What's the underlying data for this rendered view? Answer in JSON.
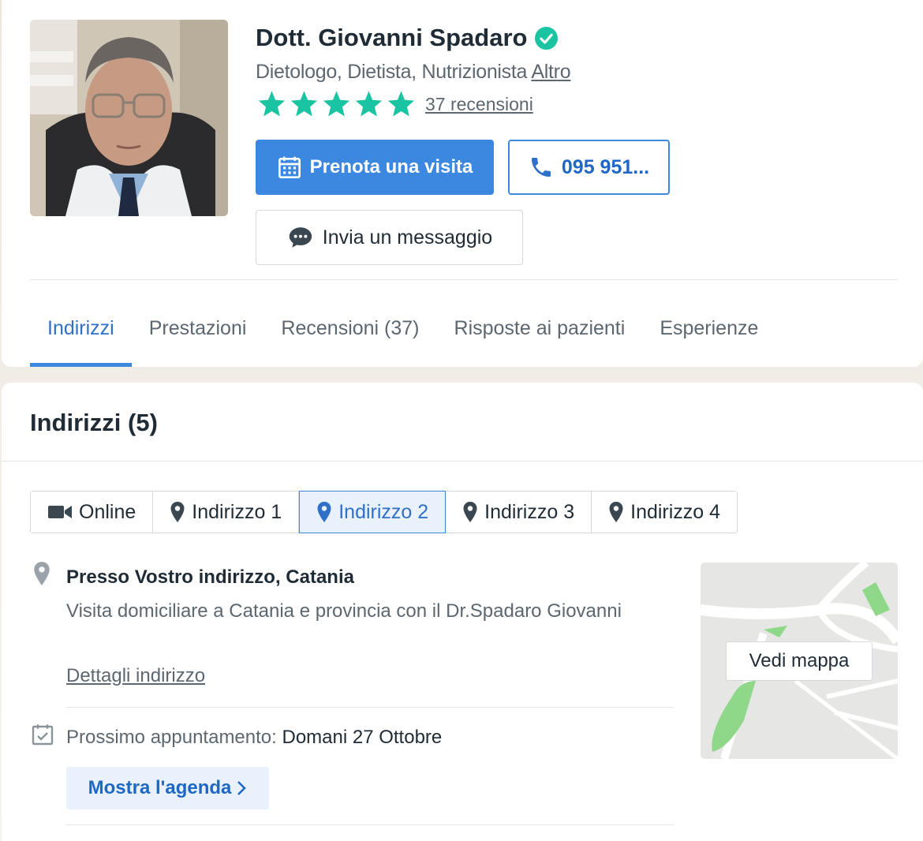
{
  "profile": {
    "name": "Dott. Giovanni Spadaro",
    "specialties": "Dietologo, Dietista, Nutrizionista",
    "more_link": "Altro",
    "rating_stars": 5,
    "reviews_link": "37 recensioni",
    "book_button": "Prenota una visita",
    "phone_button": "095 951...",
    "message_button": "Invia un messaggio",
    "colors": {
      "accent": "#3c87e0",
      "star": "#1ac3a1",
      "verified": "#1ac3a1"
    }
  },
  "tabs": [
    {
      "label": "Indirizzi",
      "active": true
    },
    {
      "label": "Prestazioni",
      "active": false
    },
    {
      "label": "Recensioni (37)",
      "active": false
    },
    {
      "label": "Risposte ai pazienti",
      "active": false
    },
    {
      "label": "Esperienze",
      "active": false
    }
  ],
  "addresses": {
    "title": "Indirizzi (5)",
    "tabs": [
      {
        "label": "Online",
        "icon": "video-icon",
        "active": false
      },
      {
        "label": "Indirizzo 1",
        "icon": "pin-icon",
        "active": false
      },
      {
        "label": "Indirizzo 2",
        "icon": "pin-icon",
        "active": true
      },
      {
        "label": "Indirizzo 3",
        "icon": "pin-icon",
        "active": false
      },
      {
        "label": "Indirizzo 4",
        "icon": "pin-icon",
        "active": false
      }
    ],
    "current": {
      "name": "Presso Vostro indirizzo, Catania",
      "description": "Visita domiciliare a Catania e provincia con il Dr.Spadaro Giovanni",
      "details_link": "Dettagli indirizzo",
      "next_appointment_label": "Prossimo appuntamento:",
      "next_appointment_value": "Domani 27 Ottobre",
      "agenda_button": "Mostra l'agenda",
      "map_button": "Vedi mappa"
    }
  }
}
